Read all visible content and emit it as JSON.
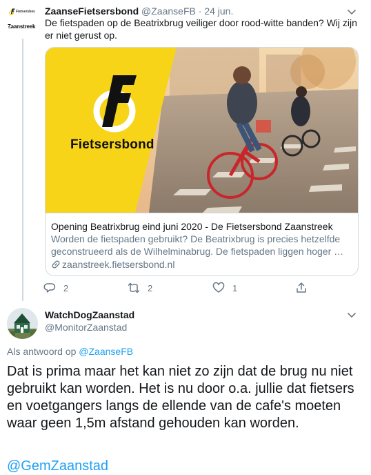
{
  "tweet1": {
    "avatar": {
      "logo_small": "Fietsersbon",
      "logo_name": "Zaanstreek"
    },
    "name": "ZaanseFietsersbond",
    "handle": "@ZaanseFB",
    "separator": "·",
    "date": "24 jun.",
    "text": "De fietspaden op de Beatrixbrug veiliger door rood-witte banden? Wij zijn er niet gerust op.",
    "card": {
      "image_brand": "Fietsersbond",
      "title": "Opening Beatrixbrug eind juni 2020 - De Fietsersbond Zaanstreek",
      "description": "Worden de fietspaden gebruikt? De Beatrixbrug is precies hetzelfde geconstrueerd als de Wilhelminabrug. De fietspaden liggen hoger …",
      "url": "zaanstreek.fietsersbond.nl"
    },
    "actions": {
      "reply_count": "2",
      "retweet_count": "2",
      "like_count": "1"
    }
  },
  "tweet2": {
    "name": "WatchDogZaanstad",
    "handle": "@MonitorZaanstad",
    "reply_prefix": "Als antwoord op",
    "reply_target": "@ZaanseFB",
    "text": "Dat is prima maar het kan niet zo zijn dat de brug nu niet gebruikt kan worden. Het is nu door o.a. jullie dat fietsers en voetgangers langs de ellende van de cafe's moeten waar geen 1,5m afstand gehouden kan worden.",
    "mention": "@GemZaanstad"
  },
  "colors": {
    "text": "#14171a",
    "secondary": "#657786",
    "link": "#1da1f2",
    "border": "#cfd9de",
    "brand_yellow": "#f7d417"
  },
  "icons": [
    "fietsersbond-logo-icon",
    "chevron-down-icon",
    "link-icon",
    "reply-icon",
    "retweet-icon",
    "like-icon",
    "share-icon"
  ]
}
